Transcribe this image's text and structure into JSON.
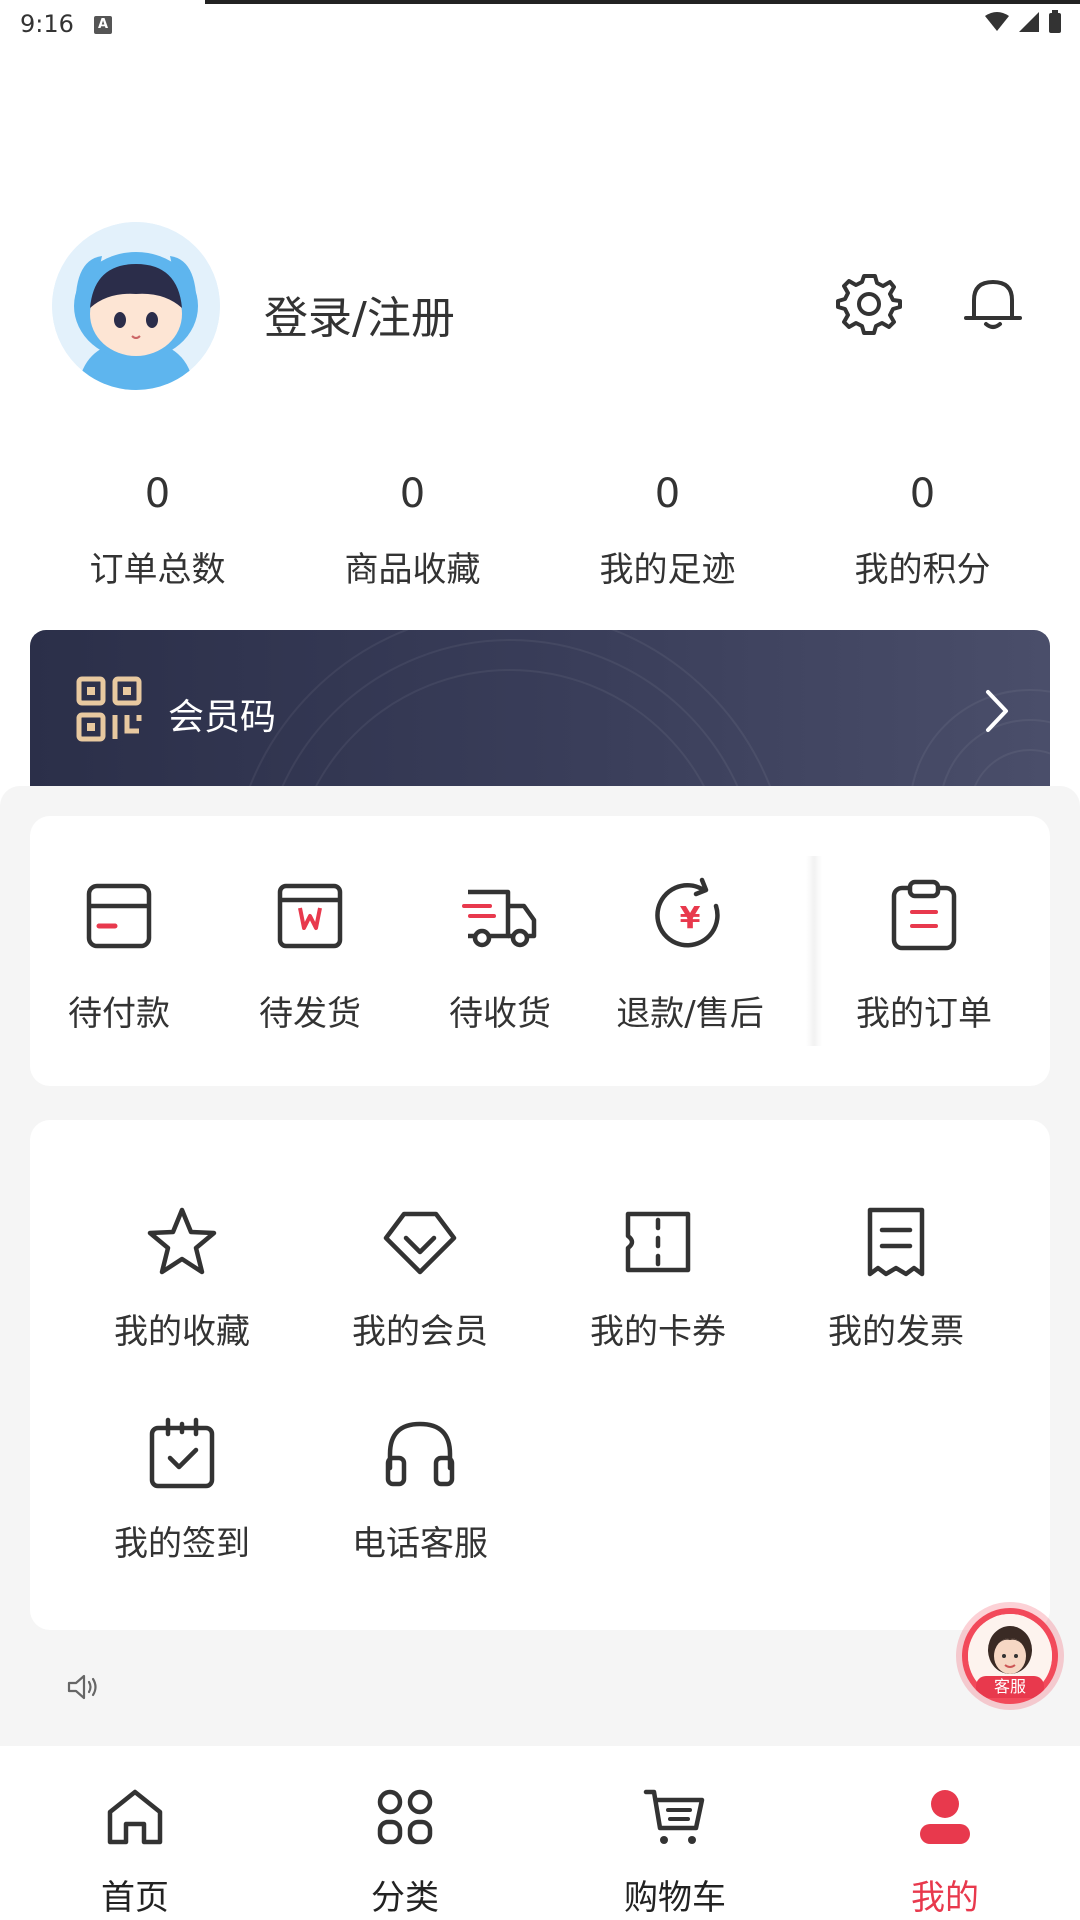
{
  "status_bar": {
    "time": "9:16",
    "notification_glyph": "A"
  },
  "profile": {
    "login_label": "登录/注册",
    "settings_icon": "gear-icon",
    "notification_icon": "bell-icon"
  },
  "stats": [
    {
      "value": "0",
      "label": "订单总数"
    },
    {
      "value": "0",
      "label": "商品收藏"
    },
    {
      "value": "0",
      "label": "我的足迹"
    },
    {
      "value": "0",
      "label": "我的积分"
    }
  ],
  "member_card": {
    "label": "会员码",
    "icon": "qr-code-icon"
  },
  "orders": [
    {
      "label": "待付款",
      "icon": "wallet-icon"
    },
    {
      "label": "待发货",
      "icon": "package-icon"
    },
    {
      "label": "待收货",
      "icon": "truck-icon"
    },
    {
      "label": "退款/售后",
      "icon": "refund-icon"
    },
    {
      "label": "我的订单",
      "icon": "clipboard-icon"
    }
  ],
  "services": [
    {
      "label": "我的收藏",
      "icon": "star-icon"
    },
    {
      "label": "我的会员",
      "icon": "diamond-icon"
    },
    {
      "label": "我的卡券",
      "icon": "ticket-icon"
    },
    {
      "label": "我的发票",
      "icon": "receipt-icon"
    },
    {
      "label": "我的签到",
      "icon": "calendar-check-icon"
    },
    {
      "label": "电话客服",
      "icon": "headphones-icon"
    }
  ],
  "customer_service": {
    "badge": "客服"
  },
  "bottom_nav": [
    {
      "label": "首页",
      "icon": "home-icon",
      "active": false
    },
    {
      "label": "分类",
      "icon": "category-icon",
      "active": false
    },
    {
      "label": "购物车",
      "icon": "cart-icon",
      "active": false
    },
    {
      "label": "我的",
      "icon": "user-icon",
      "active": true
    }
  ],
  "colors": {
    "accent": "#e8394d",
    "card_dark": "#2b2f49",
    "background_grey": "#f5f5f5",
    "qr_gold": "#e8c9a0"
  }
}
